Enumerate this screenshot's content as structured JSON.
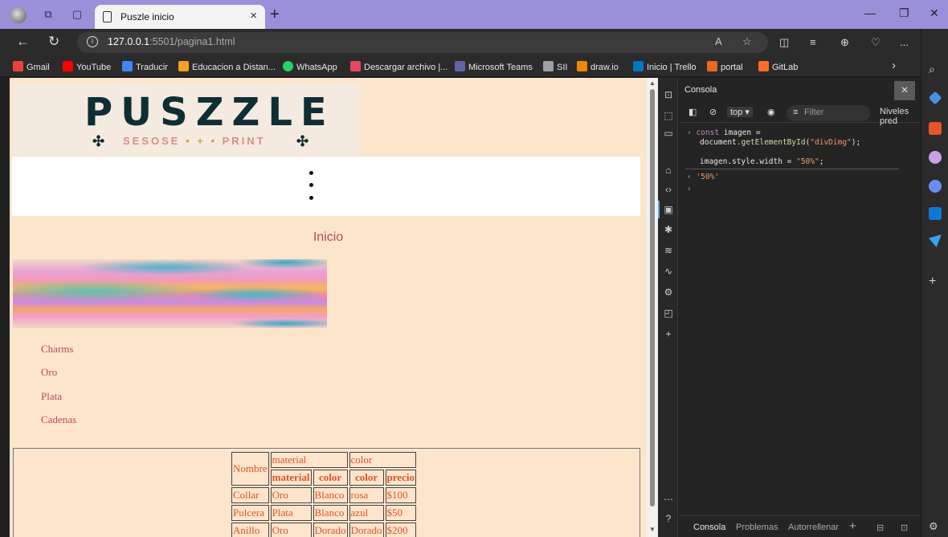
{
  "browser": {
    "tab_title": "Puszle inicio",
    "url_host": "127.0.0.1",
    "url_rest": ":5501/pagina1.html",
    "more_label": "...",
    "bookmarks": [
      {
        "label": "Gmail",
        "color": "#ea4335"
      },
      {
        "label": "YouTube",
        "color": "#ff0000"
      },
      {
        "label": "Traducir",
        "color": "#4285f4"
      },
      {
        "label": "Educacion a Distan...",
        "color": "#f4a020"
      },
      {
        "label": "WhatsApp",
        "color": "#25d366"
      },
      {
        "label": "Descargar archivo |...",
        "color": "#e8475f"
      },
      {
        "label": "Microsoft Teams",
        "color": "#6264a7"
      },
      {
        "label": "SII",
        "color": "#9aa0a6"
      },
      {
        "label": "draw.io",
        "color": "#f08705"
      },
      {
        "label": "Inicio | Trello",
        "color": "#0079bf"
      },
      {
        "label": "portal",
        "color": "#e86a1a"
      },
      {
        "label": "GitLab",
        "color": "#fc6d26"
      }
    ]
  },
  "page": {
    "logo": {
      "title": "PUSZZLE",
      "subtitle_left": "SESOSE",
      "subtitle_dots": "• + •",
      "subtitle_right": "PRINT"
    },
    "heading": "Inicio",
    "nav_links": [
      "Charms",
      "Oro",
      "Plata",
      "Cadenas"
    ],
    "table": {
      "row1": {
        "nombre": "Nombre",
        "material": "material",
        "color": "color"
      },
      "row2": [
        "material",
        "color",
        "color",
        "precio"
      ],
      "rows": [
        [
          "Collar",
          "Oro",
          "Blanco",
          "rosa",
          "$100"
        ],
        [
          "Pulcera",
          "Plata",
          "Blanco",
          "azul",
          "$50"
        ],
        [
          "Anillo",
          "Oro",
          "Dorado",
          "Dorado",
          "$200"
        ]
      ]
    }
  },
  "devtools": {
    "panel_title": "Consola",
    "context": "top",
    "filter_placeholder": "Filter",
    "levels_label": "Niveles pred",
    "code_line1_kw": "const",
    "code_line1_rest": " imagen =",
    "code_line2_pre": "document.",
    "code_line2_fn": "getElementById",
    "code_line2_open": "(",
    "code_line2_str": "\"divDimg\"",
    "code_line2_close": ");",
    "code_line3_pre": "imagen.style.width = ",
    "code_line3_str": "\"50%\"",
    "code_line3_close": ";",
    "result": "'50%'",
    "bottom_tabs": [
      "Consola",
      "Problemas",
      "Autorrellenar"
    ]
  }
}
